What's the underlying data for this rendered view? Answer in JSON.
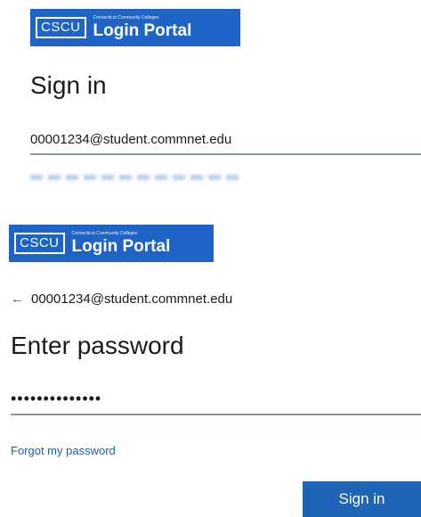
{
  "top": {
    "logo": {
      "abbr": "CSCU",
      "tagline": "Connecticut Community Colleges",
      "name": "Login Portal",
      "color": "#1e63c6"
    },
    "title": "Sign in",
    "email_value": "00001234@student.commnet.edu"
  },
  "bottom": {
    "logo": {
      "abbr": "CSCU",
      "tagline": "Connecticut Community Colleges",
      "name": "Login Portal",
      "color": "#1e63c6"
    },
    "back_icon": "arrow-left-icon",
    "identity": "00001234@student.commnet.edu",
    "title": "Enter password",
    "password_value": "••••••••••••••",
    "forgot_link": "Forgot my password",
    "sign_in_label": "Sign in",
    "button_color": "#1e64b7"
  }
}
